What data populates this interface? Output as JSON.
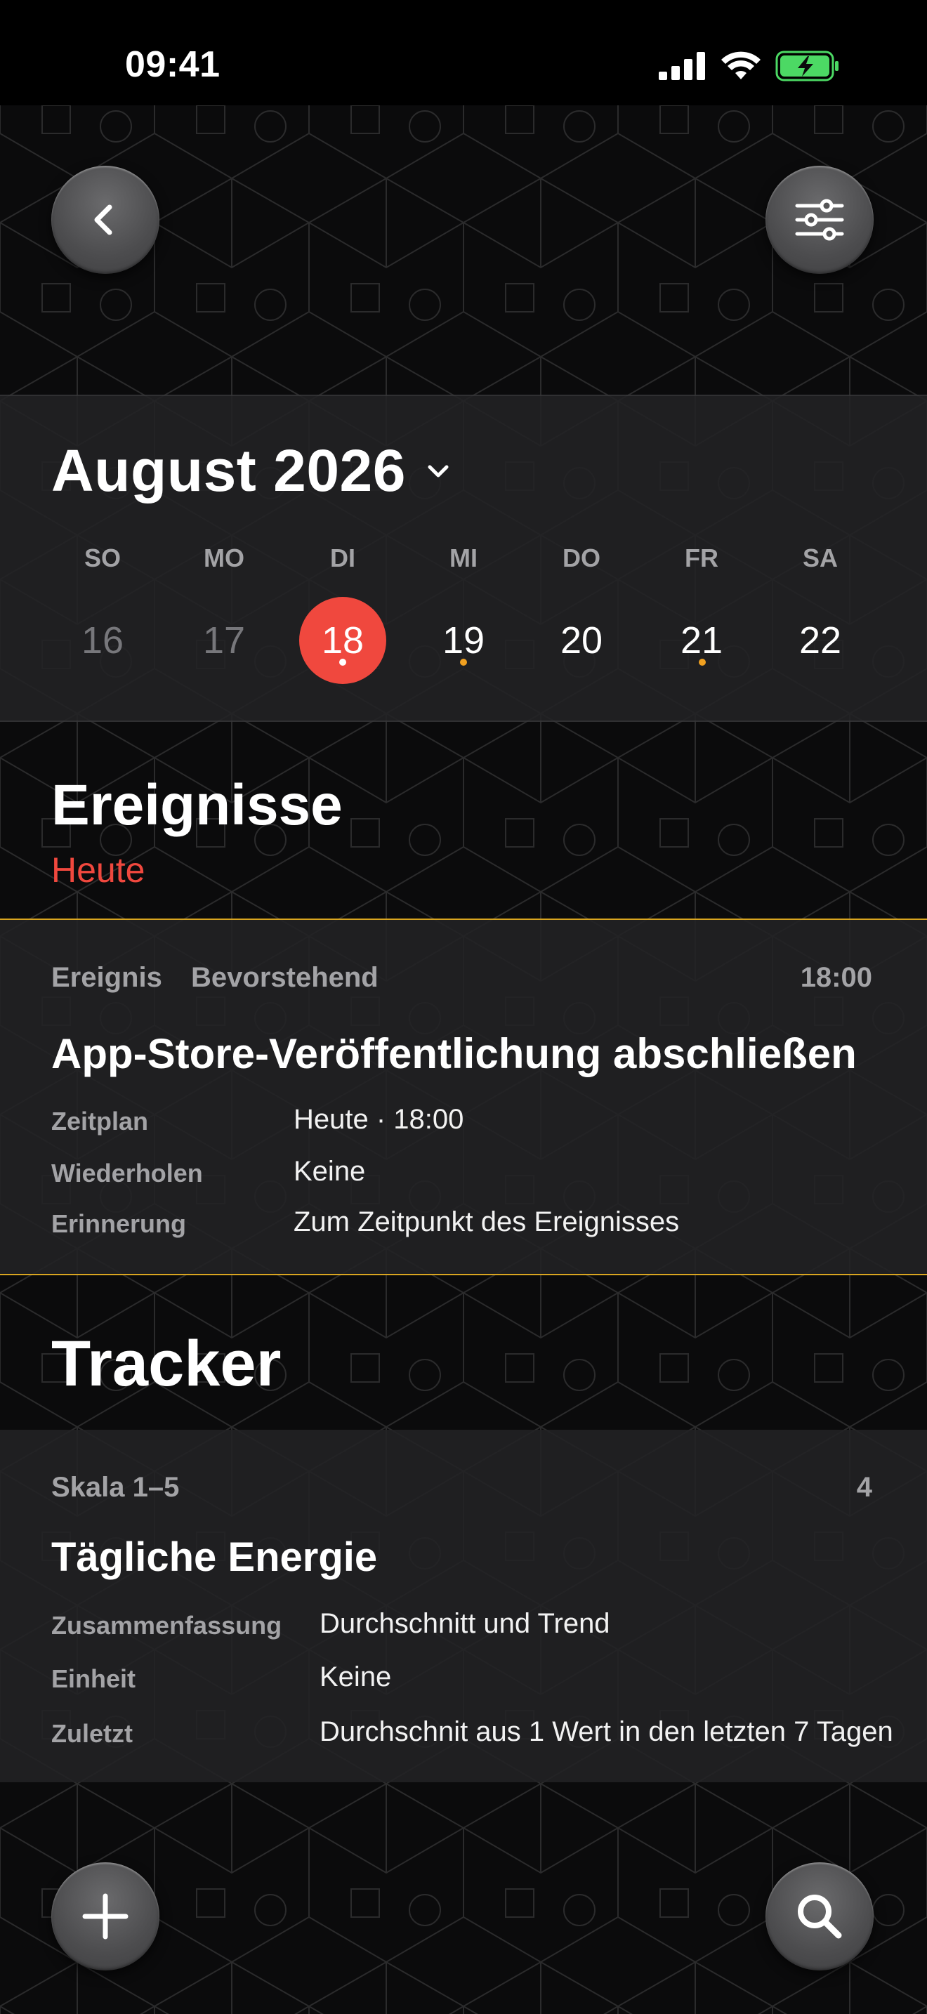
{
  "status_bar": {
    "time": "09:41"
  },
  "nav": {
    "back_icon": "chevron-left-icon",
    "filter_icon": "sliders-icon"
  },
  "calendar": {
    "month_label": "August 2026",
    "weekdays": [
      "SO",
      "MO",
      "DI",
      "MI",
      "DO",
      "FR",
      "SA"
    ],
    "days": [
      "16",
      "17",
      "18",
      "19",
      "20",
      "21",
      "22"
    ],
    "selected_day": "18",
    "dot_colors": {
      "today": "#ffffff",
      "event": "#f0a020"
    },
    "accent": "#f0483e"
  },
  "events": {
    "title": "Ereignisse",
    "subtitle": "Heute",
    "card": {
      "kind": "Ereignis",
      "state": "Bevorstehend",
      "time": "18:00",
      "title": "App-Store-Veröffentlichung abschließen",
      "rows": [
        {
          "label": "Zeitplan",
          "value": "Heute · 18:00"
        },
        {
          "label": "Wiederholen",
          "value": "Keine"
        },
        {
          "label": "Erinnerung",
          "value": "Zum Zeitpunkt des Ereignisses"
        }
      ],
      "border_color": "#d9a520"
    }
  },
  "tracker": {
    "title": "Tracker",
    "card": {
      "scale": "Skala 1–5",
      "value": "4",
      "title": "Tägliche Energie",
      "rows": [
        {
          "label": "Zusammenfassung",
          "value": "Durchschnitt und Trend"
        },
        {
          "label": "Einheit",
          "value": "Keine"
        },
        {
          "label": "Zuletzt",
          "value": "Durchschnit aus 1 Wert in den letzten 7 Tagen"
        }
      ]
    }
  },
  "bottom_bar": {
    "add_icon": "plus-icon",
    "search_icon": "search-icon"
  }
}
